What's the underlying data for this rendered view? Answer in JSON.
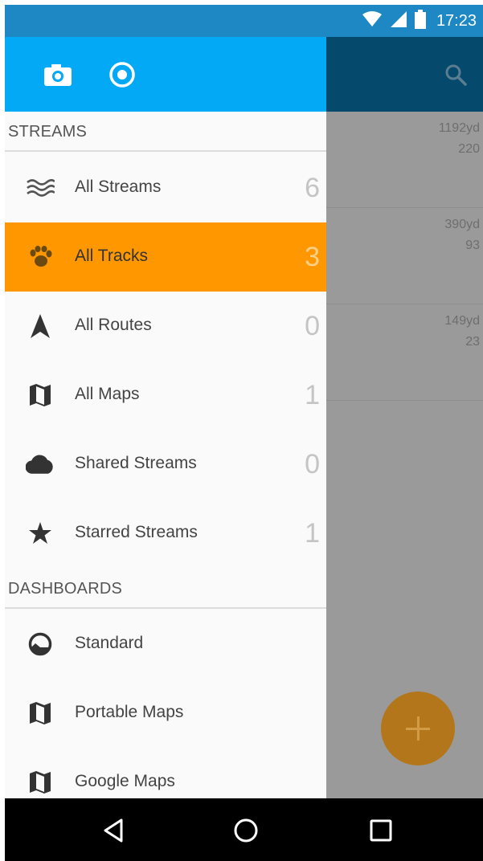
{
  "status_bar": {
    "time": "17:23",
    "bg_color": "#1d88c4"
  },
  "drawer": {
    "header_color": "#03a9f4",
    "header_icons": [
      "camera-icon",
      "record-icon"
    ],
    "streams_header": "STREAMS",
    "streams": [
      {
        "icon": "waves-icon",
        "label": "All Streams",
        "count": "6"
      },
      {
        "icon": "paw-icon",
        "label": "All Tracks",
        "count": "3",
        "active": true
      },
      {
        "icon": "navigation-arrow-icon",
        "label": "All Routes",
        "count": "0"
      },
      {
        "icon": "map-icon",
        "label": "All Maps",
        "count": "1"
      },
      {
        "icon": "cloud-icon",
        "label": "Shared Streams",
        "count": "0"
      },
      {
        "icon": "star-icon",
        "label": "Starred Streams",
        "count": "1"
      }
    ],
    "dashboards_header": "DASHBOARDS",
    "dashboards": [
      {
        "icon": "gauge-icon",
        "label": "Standard"
      },
      {
        "icon": "map-icon",
        "label": "Portable Maps"
      },
      {
        "icon": "map-icon",
        "label": "Google Maps"
      }
    ],
    "active_color": "#ff9800"
  },
  "background_list": {
    "toolbar_color": "#054a6d",
    "rows": [
      {
        "distance": "1192yd",
        "value": "220"
      },
      {
        "distance": "390yd",
        "value": "93"
      },
      {
        "distance": "149yd",
        "value": "23"
      }
    ]
  },
  "nav_bar": {
    "buttons": [
      "back-icon",
      "home-icon",
      "recents-icon"
    ]
  }
}
